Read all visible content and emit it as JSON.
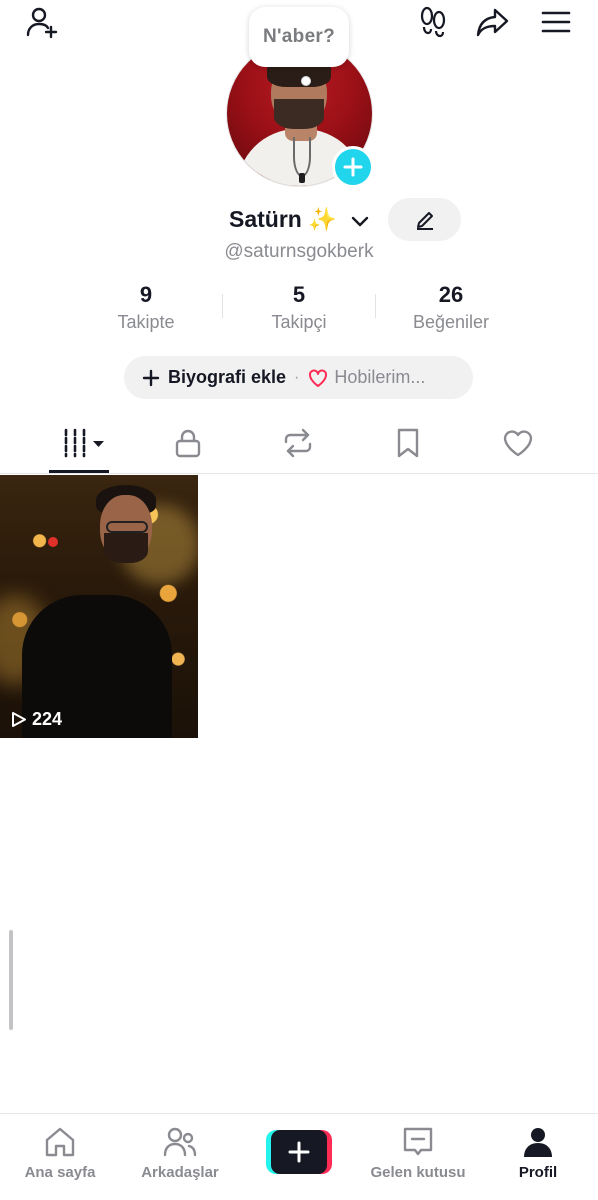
{
  "status_bubble": {
    "text": "N'aber?"
  },
  "profile": {
    "display_name": "Satürn ✨",
    "username": "@saturnsgokberk"
  },
  "stats": [
    {
      "value": "9",
      "label": "Takipte"
    },
    {
      "value": "5",
      "label": "Takipçi"
    },
    {
      "value": "26",
      "label": "Beğeniler"
    }
  ],
  "bio_pill": {
    "add_bio_label": "Biyografi ekle",
    "separator": "·",
    "hobbies_label": "Hobilerim..."
  },
  "tabs": [
    {
      "icon": "videos-grid-icon",
      "active": true
    },
    {
      "icon": "lock-icon",
      "active": false
    },
    {
      "icon": "repost-icon",
      "active": false
    },
    {
      "icon": "bookmark-icon",
      "active": false
    },
    {
      "icon": "heart-icon",
      "active": false
    }
  ],
  "videos": [
    {
      "views": "224"
    }
  ],
  "bottom_nav": [
    {
      "label": "Ana sayfa",
      "icon": "home-icon",
      "active": false
    },
    {
      "label": "Arkadaşlar",
      "icon": "friends-icon",
      "active": false
    },
    {
      "label": "",
      "icon": "create-plus-icon",
      "active": false
    },
    {
      "label": "Gelen kutusu",
      "icon": "inbox-icon",
      "active": false
    },
    {
      "label": "Profil",
      "icon": "profile-icon",
      "active": true
    }
  ],
  "colors": {
    "accent_cyan": "#20d5ec",
    "accent_pink": "#fe2c55",
    "text_primary": "#161823",
    "text_secondary": "#8a8b91",
    "pill_bg": "#f1f1f2"
  }
}
